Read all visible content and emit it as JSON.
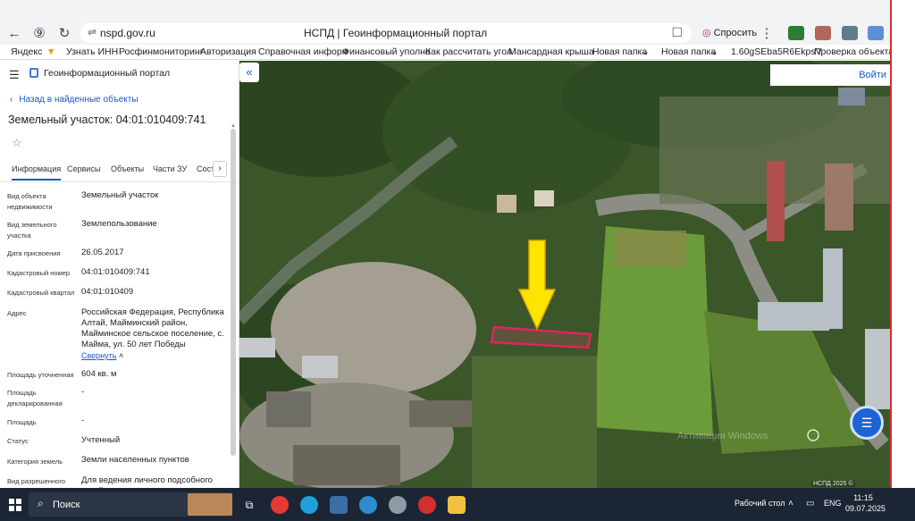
{
  "browser": {
    "url": "nspd.gov.ru",
    "page_title": "НСПД | Геоинформационный портал",
    "ask_label": "Спросить"
  },
  "bookmarks": [
    "Яндекс",
    "Узнать ИНН",
    "Росфинмониторинг",
    "Авторизация",
    "Справочная информ",
    "Финансовый уполно",
    "Как рассчитать угол",
    "Мансардная крыша",
    "Новая папка",
    "Новая папка",
    "1.60gSEba5R6EkpsV",
    "Проверка объекта н"
  ],
  "panel": {
    "portal_title": "Геоинформационный портал",
    "back_label": "Назад в найденные объекты",
    "object_title": "Земельный участок: 04:01:010409:741",
    "tabs": [
      "Информация",
      "Сервисы",
      "Объекты",
      "Части ЗУ",
      "Сост"
    ],
    "rows": [
      {
        "label": "Вид объекта недвижимости",
        "value": "Земельный участок"
      },
      {
        "label": "Вид земельного участка",
        "value": "Землепользование"
      },
      {
        "label": "Дата присвоения",
        "value": "26.05.2017"
      },
      {
        "label": "Кадастровый номер",
        "value": "04:01:010409:741"
      },
      {
        "label": "Кадастровый квартал",
        "value": "04:01:010409"
      },
      {
        "label": "Адрес",
        "value": "Российская Федерация, Республика Алтай, Майминский район, Майминское сельское поселение, с. Майма, ул. 50 лет Победы"
      },
      {
        "label": "Площадь уточненная",
        "value": "604 кв. м"
      },
      {
        "label": "Площадь декларированная",
        "value": "-"
      },
      {
        "label": "Площадь",
        "value": "-"
      },
      {
        "label": "Статус",
        "value": "Учтенный"
      },
      {
        "label": "Категория земель",
        "value": "Земли населенных пунктов"
      },
      {
        "label": "Вид разрешенного",
        "value": "Для ведения личного подсобного хозяйства"
      }
    ],
    "collapse_link": "Свернуть"
  },
  "map": {
    "login_label": "Войти",
    "watermark": "Активация Windows",
    "copyright": "НСПД 2025 ©",
    "colors": {
      "parcel": "#e0245e",
      "arrow": "#ffe400",
      "accent": "#1e63d6"
    }
  },
  "taskbar": {
    "search_label": "Поиск",
    "desktop_label": "Рабочий стол",
    "lang": "ENG",
    "time": "11:15",
    "date": "09.07.2025"
  }
}
